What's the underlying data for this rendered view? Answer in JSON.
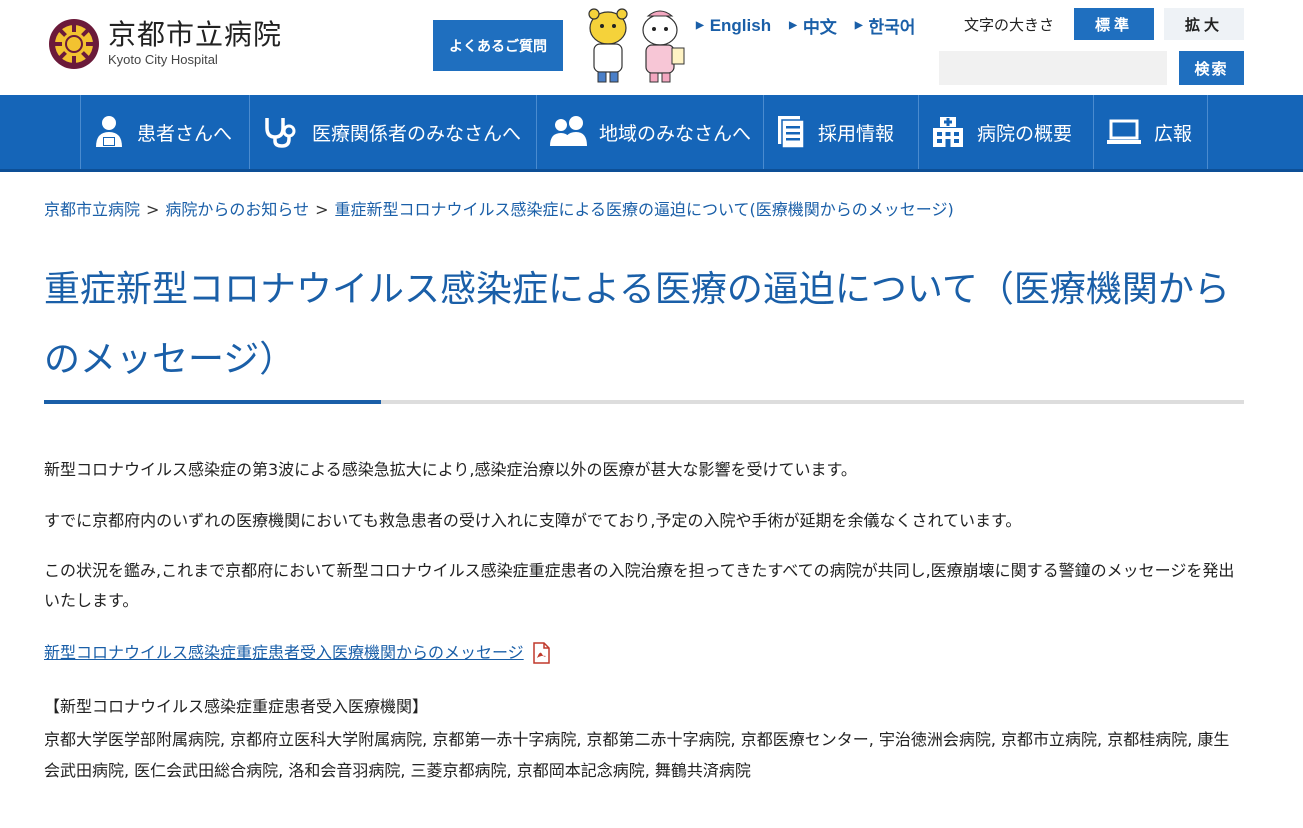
{
  "header": {
    "logo_jp": "京都市立病院",
    "logo_en": "Kyoto City Hospital",
    "faq_label": "よくあるご質問",
    "languages": [
      "English",
      "中文",
      "한국어"
    ],
    "font_size_label": "文字の大きさ",
    "font_standard": "標準",
    "font_large": "拡大",
    "search_placeholder": "",
    "search_button": "検索"
  },
  "nav": {
    "items": [
      {
        "label": "患者さんへ",
        "icon": "patient-icon"
      },
      {
        "label": "医療関係者のみなさんへ",
        "icon": "stethoscope-icon"
      },
      {
        "label": "地域のみなさんへ",
        "icon": "community-icon"
      },
      {
        "label": "採用情報",
        "icon": "document-icon"
      },
      {
        "label": "病院の概要",
        "icon": "hospital-icon"
      },
      {
        "label": "広報",
        "icon": "laptop-icon"
      }
    ]
  },
  "breadcrumb": {
    "items": [
      "京都市立病院",
      "病院からのお知らせ",
      "重症新型コロナウイルス感染症による医療の逼迫について(医療機関からのメッセージ)"
    ],
    "separator": ">"
  },
  "page": {
    "title": "重症新型コロナウイルス感染症による医療の逼迫について（医療機関からのメッセージ）",
    "paragraphs": [
      "新型コロナウイルス感染症の第3波による感染急拡大により,感染症治療以外の医療が甚大な影響を受けています。",
      "すでに京都府内のいずれの医療機関においても救急患者の受け入れに支障がでており,予定の入院や手術が延期を余儀なくされています。",
      "この状況を鑑み,これまで京都府において新型コロナウイルス感染症重症患者の入院治療を担ってきたすべての病院が共同し,医療崩壊に関する警鐘のメッセージを発出いたします。"
    ],
    "doc_link": "新型コロナウイルス感染症重症患者受入医療機関からのメッセージ",
    "list_heading": "【新型コロナウイルス感染症重症患者受入医療機関】",
    "hospitals": "京都大学医学部附属病院, 京都府立医科大学附属病院, 京都第一赤十字病院, 京都第二赤十字病院, 京都医療センター, 宇治徳洲会病院, 京都市立病院, 京都桂病院, 康生会武田病院, 医仁会武田総合病院, 洛和会音羽病院, 三菱京都病院, 京都岡本記念病院, 舞鶴共済病院"
  },
  "colors": {
    "primary": "#1f6fbf",
    "nav_bg": "#1565b8",
    "link": "#1a5fa8"
  }
}
